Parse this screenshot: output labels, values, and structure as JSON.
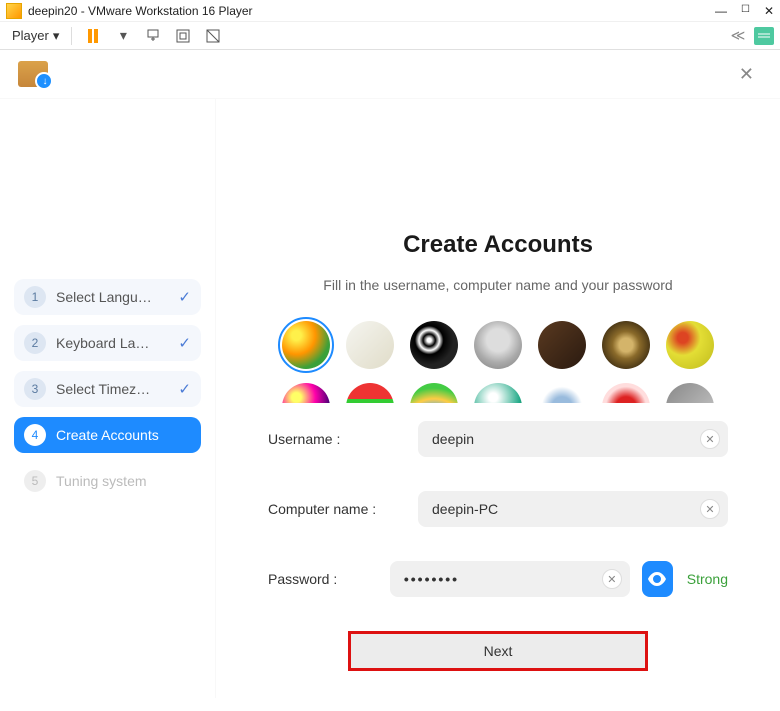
{
  "vmware": {
    "title": "deepin20 - VMware Workstation 16 Player",
    "player_menu": "Player"
  },
  "sidebar": {
    "steps": [
      {
        "num": "1",
        "label": "Select Langu…",
        "done": true
      },
      {
        "num": "2",
        "label": "Keyboard La…",
        "done": true
      },
      {
        "num": "3",
        "label": "Select Timez…",
        "done": true
      },
      {
        "num": "4",
        "label": "Create Accounts",
        "active": true
      },
      {
        "num": "5",
        "label": "Tuning system",
        "future": true
      }
    ]
  },
  "main": {
    "title": "Create Accounts",
    "subtitle": "Fill in the username, computer name and your password",
    "username_label": "Username :",
    "computer_label": "Computer name :",
    "password_label": "Password :",
    "username_value": "deepin",
    "computer_value": "deepin-PC",
    "password_value": "••••••••",
    "strength": "Strong",
    "next_label": "Next"
  }
}
